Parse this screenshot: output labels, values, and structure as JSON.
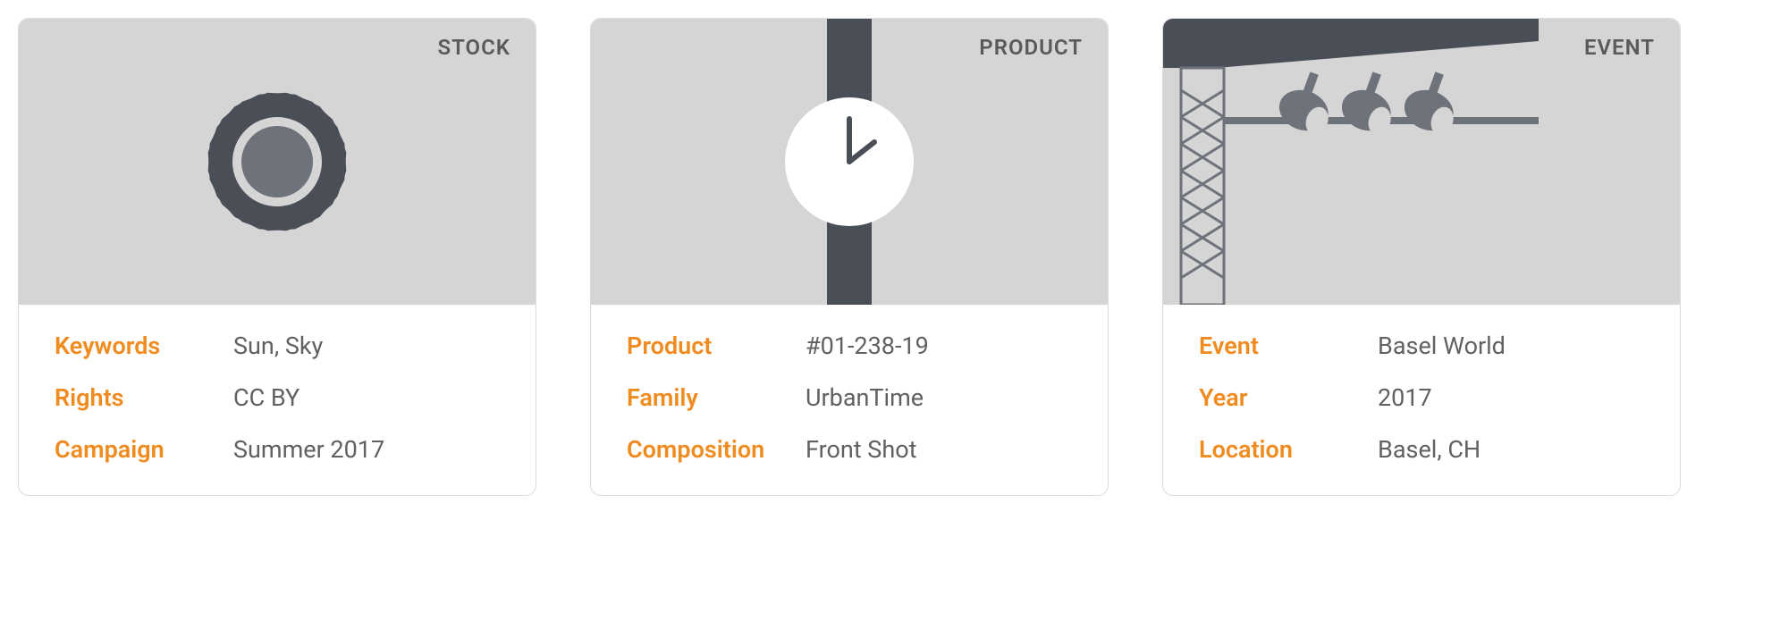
{
  "cards": [
    {
      "tag": "STOCK",
      "icon": "sun-icon",
      "fields": [
        {
          "key": "Keywords",
          "value": "Sun, Sky"
        },
        {
          "key": "Rights",
          "value": "CC BY"
        },
        {
          "key": "Campaign",
          "value": "Summer 2017"
        }
      ]
    },
    {
      "tag": "PRODUCT",
      "icon": "watch-icon",
      "fields": [
        {
          "key": "Product",
          "value": "#01-238-19"
        },
        {
          "key": "Family",
          "value": "UrbanTime"
        },
        {
          "key": "Composition",
          "value": "Front Shot"
        }
      ]
    },
    {
      "tag": "EVENT",
      "icon": "stage-lights-icon",
      "fields": [
        {
          "key": "Event",
          "value": "Basel World"
        },
        {
          "key": "Year",
          "value": "2017"
        },
        {
          "key": "Location",
          "value": "Basel, CH"
        }
      ]
    }
  ],
  "colors": {
    "accent": "#ef8b1f",
    "text": "#5f6163",
    "headerBg": "#d5d5d5",
    "iconDark": "#4a4e57",
    "iconLight": "#ffffff",
    "iconMid": "#6e727a"
  }
}
